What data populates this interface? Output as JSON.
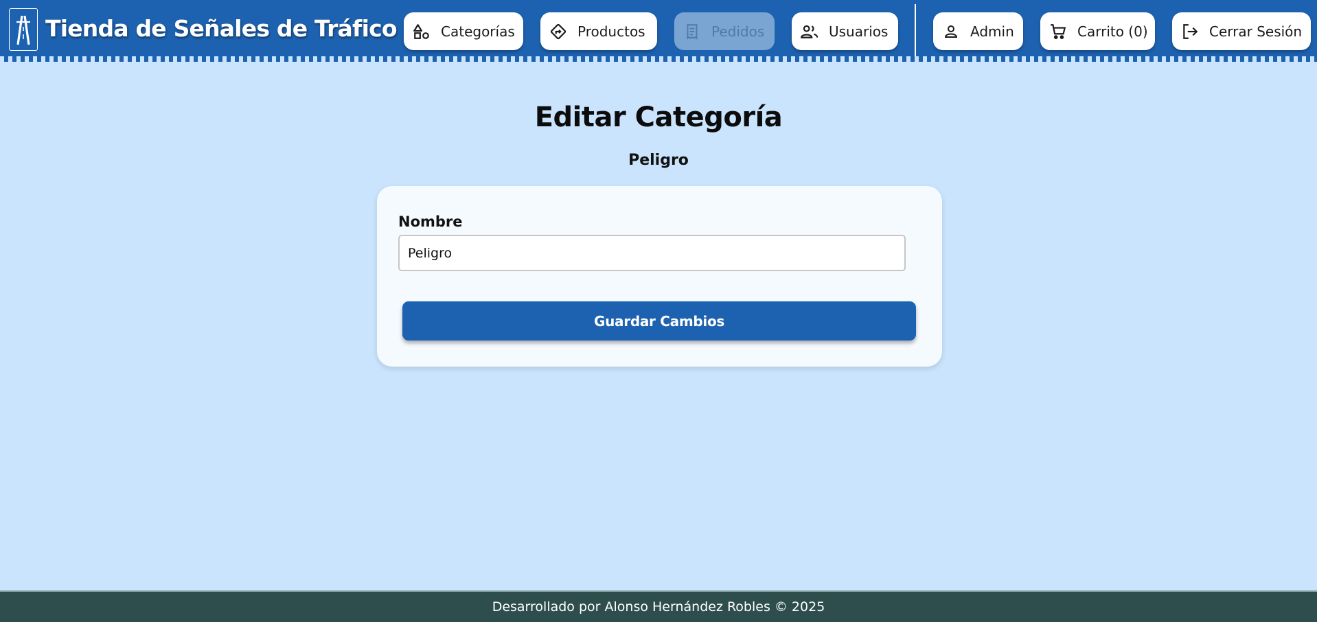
{
  "header": {
    "site_title": "Tienda de Señales de Tráfico",
    "nav": {
      "categorias": {
        "label": "Categorías",
        "icon": "shapes-icon"
      },
      "productos": {
        "label": "Productos",
        "icon": "directions-sign-icon"
      },
      "pedidos": {
        "label": "Pedidos",
        "icon": "receipt-icon",
        "disabled": true
      },
      "usuarios": {
        "label": "Usuarios",
        "icon": "group-icon"
      },
      "admin": {
        "label": "Admin",
        "icon": "person-icon"
      },
      "carrito": {
        "label": "Carrito (0)",
        "icon": "cart-icon"
      },
      "logout": {
        "label": "Cerrar Sesión",
        "icon": "logout-icon"
      }
    }
  },
  "main": {
    "title": "Editar Categoría",
    "subtitle": "Peligro",
    "form": {
      "name_label": "Nombre",
      "name_value": "Peligro",
      "submit_label": "Guardar Cambios"
    }
  },
  "footer": {
    "text": "Desarrollado por Alonso Hernández Robles © 2025"
  },
  "colors": {
    "header_bg": "#1d62b0",
    "page_bg": "#c9e4fc",
    "card_bg": "#f5faff",
    "primary_button": "#1d62b0",
    "footer_bg": "#2e4e4e",
    "disabled_nav": "#7aa5d3"
  }
}
